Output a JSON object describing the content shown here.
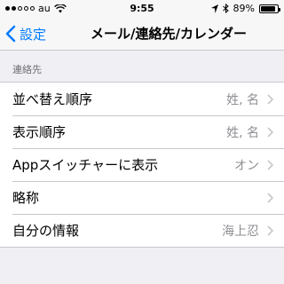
{
  "status_bar": {
    "carrier": "au",
    "time": "9:55",
    "battery_text": "89%",
    "battery_level": 0.89
  },
  "nav": {
    "back_label": "設定",
    "title": "メール/連絡先/カレンダー"
  },
  "section": {
    "header": "連絡先",
    "rows": [
      {
        "label": "並べ替え順序",
        "value": "姓, 名"
      },
      {
        "label": "表示順序",
        "value": "姓, 名"
      },
      {
        "label": "Appスイッチャーに表示",
        "value": "オン"
      },
      {
        "label": "略称",
        "value": ""
      },
      {
        "label": "自分の情報",
        "value": "海上忍"
      }
    ]
  },
  "colors": {
    "accent": "#007aff",
    "background": "#efeff4",
    "secondary_text": "#8e8e93"
  }
}
